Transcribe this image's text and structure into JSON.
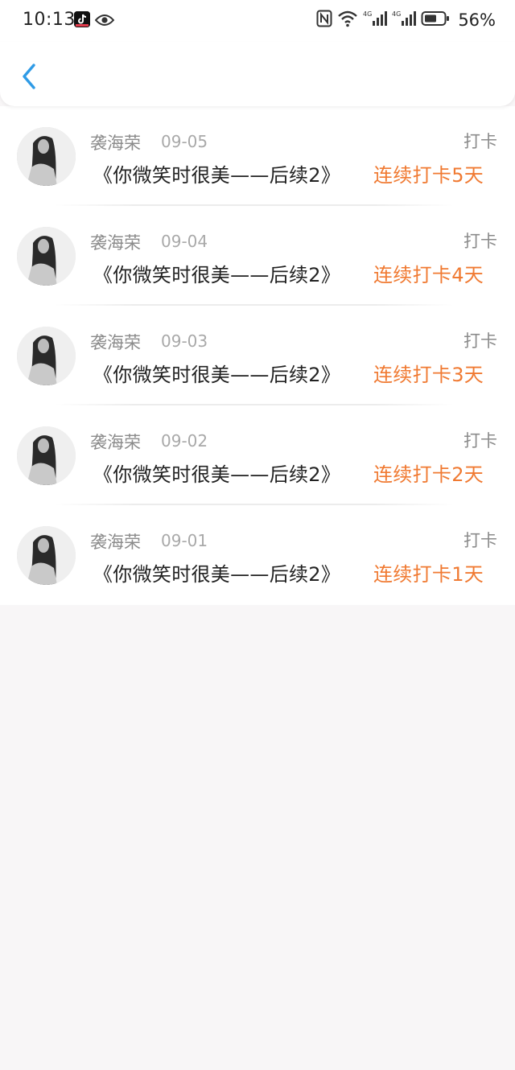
{
  "status_bar": {
    "time": "10:13",
    "battery": "56%"
  },
  "list": {
    "items": [
      {
        "author": "袭海荣",
        "date": "09-05",
        "badge": "打卡",
        "title": "《你微笑时很美——后续2》",
        "streak": "连续打卡5天"
      },
      {
        "author": "袭海荣",
        "date": "09-04",
        "badge": "打卡",
        "title": "《你微笑时很美——后续2》",
        "streak": "连续打卡4天"
      },
      {
        "author": "袭海荣",
        "date": "09-03",
        "badge": "打卡",
        "title": "《你微笑时很美——后续2》",
        "streak": "连续打卡3天"
      },
      {
        "author": "袭海荣",
        "date": "09-02",
        "badge": "打卡",
        "title": "《你微笑时很美——后续2》",
        "streak": "连续打卡2天"
      },
      {
        "author": "袭海荣",
        "date": "09-01",
        "badge": "打卡",
        "title": "《你微笑时很美——后续2》",
        "streak": "连续打卡1天"
      }
    ]
  },
  "icons": {
    "back": "chevron-left-icon",
    "tiktok": "tiktok-icon",
    "eye": "eye-icon",
    "nfc": "nfc-icon",
    "wifi": "wifi-icon",
    "signal": "signal-icon",
    "battery": "battery-icon"
  },
  "colors": {
    "accent_back": "#2f9be6",
    "streak": "#f07a32",
    "muted_text": "#8b8b8b",
    "background": "#f8f6f7"
  }
}
